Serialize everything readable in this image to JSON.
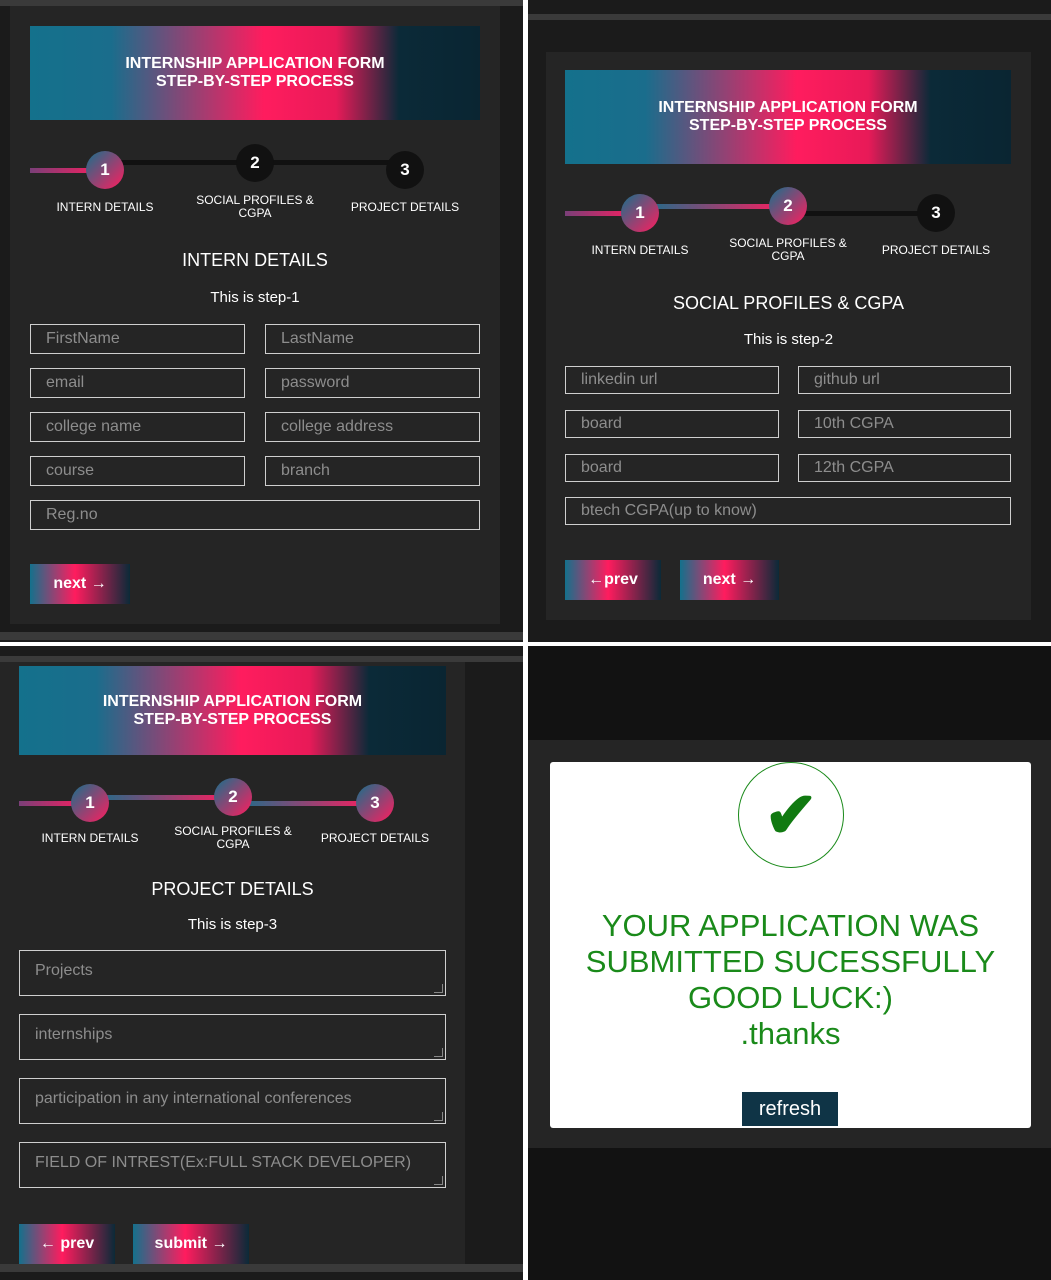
{
  "header": {
    "line1": "INTERNSHIP APPLICATION FORM",
    "line2": "STEP-BY-STEP PROCESS"
  },
  "steps": [
    {
      "number": "1",
      "label": "INTERN DETAILS"
    },
    {
      "number": "2",
      "label": "SOCIAL PROFILES & CGPA"
    },
    {
      "number": "3",
      "label": "PROJECT DETAILS"
    }
  ],
  "step1": {
    "title": "INTERN DETAILS",
    "subtitle": "This is step-1",
    "fields": [
      "FirstName",
      "LastName",
      "email",
      "password",
      "college name",
      "college address",
      "course",
      "branch",
      "Reg.no"
    ],
    "next_label": "next →"
  },
  "step2": {
    "title": "SOCIAL PROFILES & CGPA",
    "subtitle": "This is step-2",
    "fields": [
      "linkedin url",
      "github url",
      "board",
      "10th CGPA",
      "board",
      "12th CGPA",
      "btech CGPA(up to know)"
    ],
    "prev_label": "←prev",
    "next_label": "next →"
  },
  "step3": {
    "title": "PROJECT DETAILS",
    "subtitle": "This is step-3",
    "fields": [
      "Projects",
      "internships",
      "participation in any international conferences",
      "FIELD OF INTREST(Ex:FULL STACK DEVELOPER)"
    ],
    "prev_label": "← prev",
    "submit_label": "submit →"
  },
  "success": {
    "icon": "check-icon",
    "line1": "YOUR APPLICATION WAS",
    "line2": "SUBMITTED SUCESSFULLY",
    "line3": "GOOD LUCK:)",
    "line4": ".thanks",
    "refresh_label": "refresh"
  },
  "colors": {
    "accent_pink": "#ff1c5e",
    "accent_teal": "#14718c",
    "dark_navy": "#0f3446",
    "success_green": "#1a8a1a"
  }
}
